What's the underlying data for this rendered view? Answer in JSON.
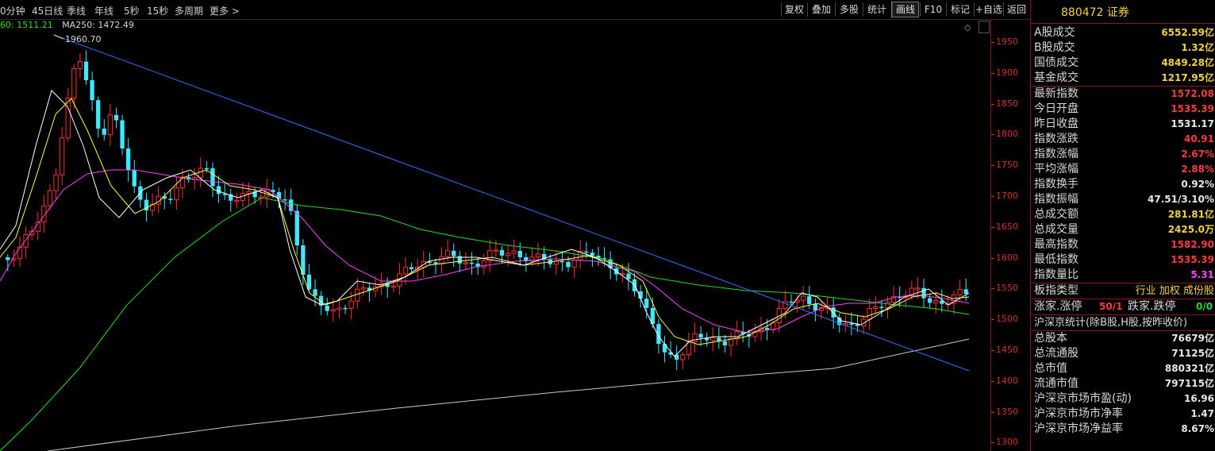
{
  "toolbar": {
    "periods": [
      "0分钟",
      "45日线",
      "季线",
      "年线",
      "5秒",
      "15秒",
      "多周期",
      "更多 >"
    ],
    "buttons": [
      "复权",
      "叠加",
      "多股",
      "统计",
      "画线",
      "F10",
      "标记",
      "+自选",
      "返回"
    ],
    "active_button": "画线"
  },
  "ma_readout": {
    "ma60": "60: 1511.21",
    "ma250": "MA250: 1472.49"
  },
  "chart": {
    "high_label": "1960.70",
    "y_ticks": [
      "1950",
      "1900",
      "1850",
      "1800",
      "1750",
      "1700",
      "1650",
      "1600",
      "1550",
      "1500",
      "1450",
      "1400",
      "1350",
      "1300"
    ],
    "colors": {
      "up": "#ff3030",
      "down": "#40e8ff",
      "ma5": "#ffffff",
      "ma10": "#ffff40",
      "ma20": "#ff40ff",
      "ma60": "#20e020",
      "ma250": "#c8c8c8",
      "trendline": "#3070ff"
    }
  },
  "sidebar": {
    "title": "880472 证券",
    "rows": [
      {
        "label": "A股成交",
        "value": "6552.59亿",
        "color": "#f2d23a"
      },
      {
        "label": "B股成交",
        "value": "1.32亿",
        "color": "#f2d23a"
      },
      {
        "label": "国债成交",
        "value": "4849.28亿",
        "color": "#f2d23a"
      },
      {
        "label": "基金成交",
        "value": "1217.95亿",
        "color": "#f2d23a"
      },
      {
        "label": "最新指数",
        "value": "1572.08",
        "color": "#ff3a3a"
      },
      {
        "label": "今日开盘",
        "value": "1535.39",
        "color": "#ff3a3a"
      },
      {
        "label": "昨日收盘",
        "value": "1531.17",
        "color": "#e8e8e8"
      },
      {
        "label": "指数涨跌",
        "value": "40.91",
        "color": "#ff3a3a"
      },
      {
        "label": "指数涨幅",
        "value": "2.67%",
        "color": "#ff3a3a"
      },
      {
        "label": "平均涨幅",
        "value": "2.88%",
        "color": "#ff3a3a"
      },
      {
        "label": "指数换手",
        "value": "0.92%",
        "color": "#e8e8e8"
      },
      {
        "label": "指数振幅",
        "value": "47.51/3.10%",
        "color": "#e8e8e8"
      },
      {
        "label": "总成交额",
        "value": "281.81亿",
        "color": "#f2d23a"
      },
      {
        "label": "总成交量",
        "value": "2425.0万",
        "color": "#f2d23a"
      },
      {
        "label": "最高指数",
        "value": "1582.90",
        "color": "#ff3a3a"
      },
      {
        "label": "最低指数",
        "value": "1535.39",
        "color": "#ff3a3a"
      },
      {
        "label": "指数量比",
        "value": "5.31",
        "color": "#ff40ff"
      }
    ],
    "board_type": {
      "label": "板指类型",
      "value": "行业 加权 成份股"
    },
    "limit": {
      "up_label": "涨家.涨停",
      "up_value": "50/1",
      "down_label": "跌家.跌停",
      "down_value": "0/0"
    },
    "stats_header": "沪深京统计(除B股,H股,按昨收价)",
    "stats": [
      {
        "label": "总股本",
        "value": "76679亿"
      },
      {
        "label": "总流通股",
        "value": "71125亿"
      },
      {
        "label": "总市值",
        "value": "880321亿"
      },
      {
        "label": "流通市值",
        "value": "797115亿"
      },
      {
        "label": "沪深京市场市盈(动)",
        "value": "16.96"
      },
      {
        "label": "沪深京市场市净率",
        "value": "1.47"
      },
      {
        "label": "沪深京市场净益率",
        "value": "8.67%"
      }
    ]
  }
}
